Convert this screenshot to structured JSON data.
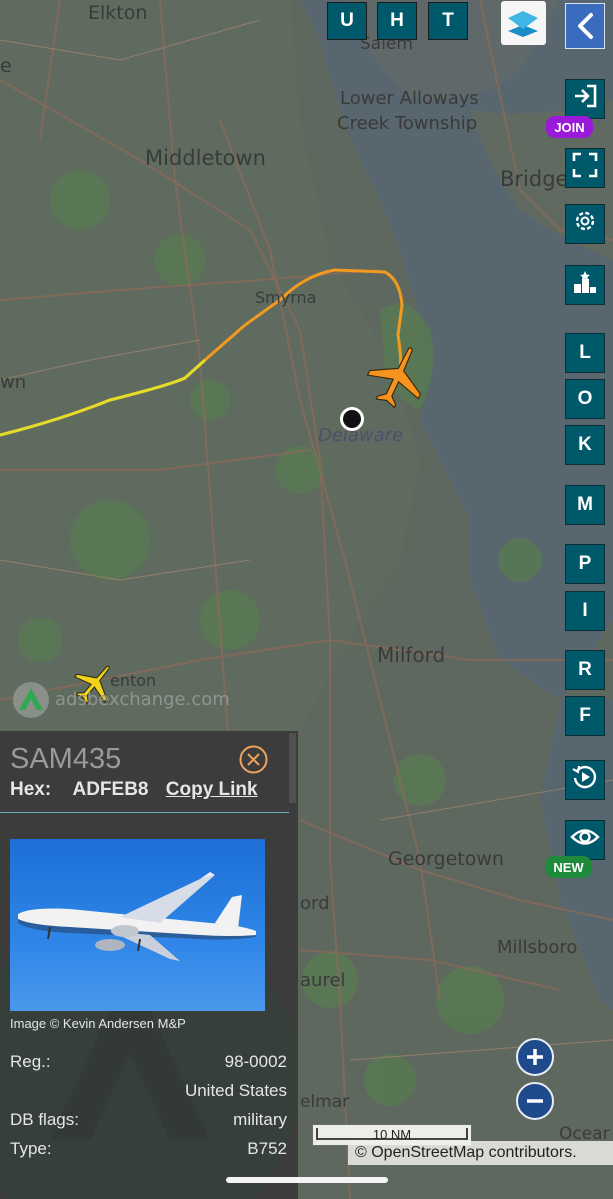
{
  "map": {
    "place_labels": {
      "elkton": "Elkton",
      "salem": "Salem",
      "lower_alloways": "Lower Alloways",
      "creek_township": "Creek Township",
      "middletown": "Middletown",
      "bridgeton": "Bridget",
      "smyrna": "Smyrna",
      "dover": "Delaware",
      "milford": "Milford",
      "georgetown": "Georgetown",
      "millsboro": "Millsboro",
      "laurel": "aurel",
      "delmar": "elmar",
      "ocean": "Ocear",
      "left_e": "e",
      "left_wn": "wn",
      "ford": "ord",
      "harrington": "enton"
    },
    "watermark": "adsbexchange.com",
    "scale_label": "10 NM",
    "attribution": "© OpenStreetMap contributors."
  },
  "top_buttons": {
    "u": "U",
    "h": "H",
    "t": "T"
  },
  "side_buttons": {
    "join_badge": "JOIN",
    "l": "L",
    "o": "O",
    "k": "K",
    "m": "M",
    "p": "P",
    "i": "I",
    "r": "R",
    "f": "F",
    "new_badge": "NEW"
  },
  "icons": {
    "layers": "layers-icon",
    "back": "chevron-left-icon",
    "join": "sign-in-icon",
    "fullscreen": "fullscreen-icon",
    "settings": "gear-icon",
    "ranking": "podium-icon",
    "replay": "replay-icon",
    "eye": "eye-icon",
    "close": "close-circle-icon"
  },
  "panel": {
    "callsign": "SAM435",
    "hex_label": "Hex:",
    "hex_value": "ADFEB8",
    "copy_link": "Copy Link",
    "photo_credit": "Image © Kevin Andersen M&P",
    "reg_label": "Reg.:",
    "reg_value": "98-0002",
    "country": "United States",
    "dbflags_label": "DB flags:",
    "dbflags_value": "military",
    "type_label": "Type:",
    "type_value": "B752"
  },
  "colors": {
    "button_bg": "#00596b",
    "join_badge": "#9b19d8",
    "new_badge": "#1e8a3a",
    "track_orange": "#f39a1c",
    "track_yellow": "#e6e02a",
    "aircraft_selected": "#f7931e",
    "aircraft_other": "#f3d21a",
    "zoom_bg": "#1f4b8c"
  }
}
